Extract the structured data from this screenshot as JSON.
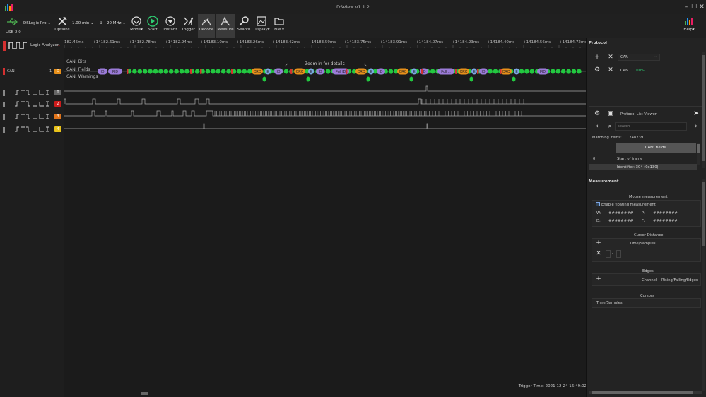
{
  "window": {
    "title": "DSView v1.1.2"
  },
  "toolbar": {
    "usb_label": "USB 2.0",
    "device": "DSLogic Pro",
    "options_label": "Options",
    "duration": "1.00 min",
    "samplerate": "20 MHz",
    "buttons": [
      {
        "label": "Mode",
        "icon": "mode-icon"
      },
      {
        "label": "Start",
        "icon": "start-icon"
      },
      {
        "label": "Instant",
        "icon": "instant-icon"
      },
      {
        "label": "Trigger",
        "icon": "trigger-icon"
      },
      {
        "label": "Decode",
        "icon": "decode-icon"
      },
      {
        "label": "Measure",
        "icon": "measure-icon"
      },
      {
        "label": "Search",
        "icon": "search-icon"
      },
      {
        "label": "Display",
        "icon": "display-icon"
      },
      {
        "label": "File",
        "icon": "file-icon"
      }
    ],
    "help_label": "Help"
  },
  "left": {
    "logic_analyzer": "Logic Analyzer",
    "can_label": "CAN",
    "can_index": "1",
    "can_badge": "D",
    "channels": [
      {
        "num": "0",
        "color": "#666666"
      },
      {
        "num": "2",
        "color": "#cc1b1b"
      },
      {
        "num": "3",
        "color": "#e0741a"
      },
      {
        "num": "4",
        "color": "#e8c21a"
      }
    ]
  },
  "ruler": {
    "ticks": [
      "182.45ms",
      "+14182.61ms",
      "+14182.78ms",
      "+14182.94ms",
      "+14183.10ms",
      "+14183.26ms",
      "+14183.42ms",
      "+14183.59ms",
      "+14183.75ms",
      "+14183.91ms",
      "+14184.07ms",
      "+14184.23ms",
      "+14184.40ms",
      "+14184.56ms",
      "+14184.72ms"
    ]
  },
  "decoder": {
    "rows": [
      "CAN: Bits",
      "CAN: Fields",
      "CAN: Warnings"
    ],
    "zoom_hint": "Zoom in for details",
    "fields": [
      "ID",
      "FID",
      "CRC",
      "E",
      "ID",
      "CRC",
      "E",
      "ID",
      "Full ID",
      "CRC",
      "E",
      "ID",
      "CRC",
      "E",
      "ID",
      "Full ...",
      "CRC",
      "E",
      "ID",
      "CRC",
      "E",
      "FID"
    ]
  },
  "protocol": {
    "title": "Protocol",
    "select_value": "CAN",
    "decoder_name": "CAN",
    "decoder_progress": "100%",
    "list_viewer": "Protocol List Viewer",
    "search_placeholder": "search",
    "matching_label": "Matching Items:",
    "matching_count": "1248239",
    "column_header": "CAN: Fields",
    "row_index": "0",
    "row_value": "Start of frame",
    "row2_value": "Identifier: 304 (0x130)"
  },
  "measurement": {
    "title": "Measurement",
    "mouse": "Mouse measurement",
    "enable_floating": "Enable floating measurement",
    "w_label": "W:",
    "w_value": "########",
    "p_label": "P:",
    "p_value": "########",
    "d_label": "D:",
    "d_value": "########",
    "f_label": "F:",
    "f_value": "########",
    "cursor_distance": "Cursor Distance",
    "time_samples": "Time/Samples",
    "edges": "Edges",
    "channel_label": "Channel",
    "edges_col": "Rising/Falling/Edges",
    "cursors": "Cursors",
    "cursors_time": "Time/Samples"
  },
  "status": {
    "trigger_time": "Trigger Time: 2021-12-24 16:49:02"
  },
  "colors": {
    "green": "#22c840",
    "orange": "#e8901a",
    "purple": "#9b7bd8",
    "blue": "#7da7e6",
    "red": "#d43030"
  }
}
